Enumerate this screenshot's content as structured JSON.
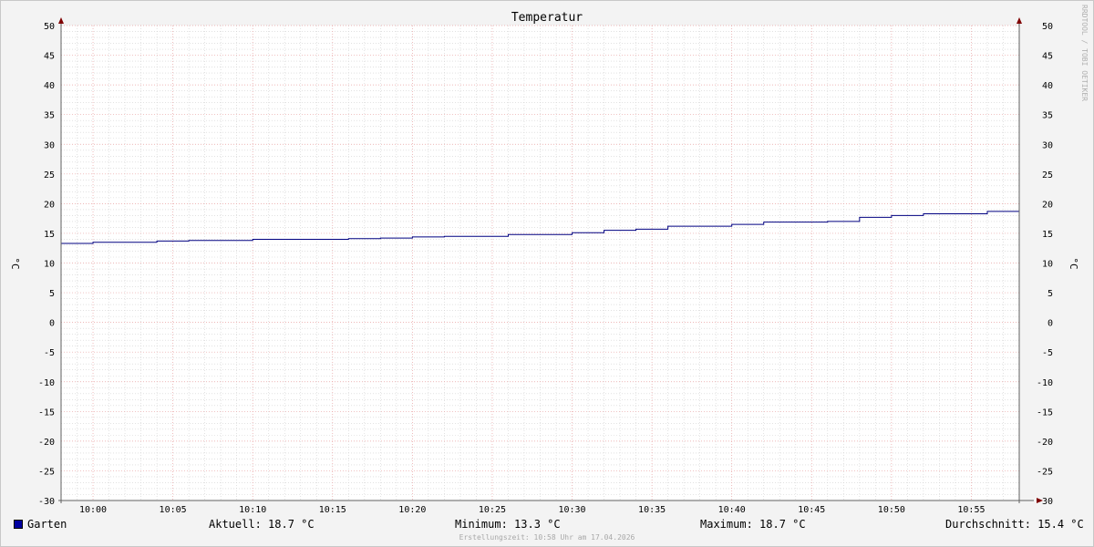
{
  "chart_data": {
    "type": "line",
    "title": "Temperatur",
    "ylabel": "°C",
    "ylabel_right": "°C",
    "ylim": [
      -30,
      50
    ],
    "yticks": [
      50,
      45,
      40,
      35,
      30,
      25,
      20,
      15,
      10,
      5,
      0,
      -5,
      -10,
      -15,
      -20,
      -25,
      -30
    ],
    "xticks": [
      "10:00",
      "10:05",
      "10:10",
      "10:15",
      "10:20",
      "10:25",
      "10:30",
      "10:35",
      "10:40",
      "10:45",
      "10:50",
      "10:55"
    ],
    "xlim_minutes": [
      -2,
      58
    ],
    "grid": true,
    "legend_position": "bottom-left",
    "series": [
      {
        "name": "Garten",
        "color": "#000080",
        "step": true,
        "x_minutes": [
          -2,
          0,
          4,
          6,
          10,
          12,
          14,
          16,
          18,
          20,
          22,
          24,
          26,
          28,
          30,
          32,
          34,
          36,
          38,
          40,
          42,
          44,
          46,
          48,
          50,
          52,
          54,
          56,
          58
        ],
        "values": [
          13.3,
          13.5,
          13.7,
          13.8,
          14.0,
          14.0,
          14.0,
          14.1,
          14.2,
          14.4,
          14.5,
          14.5,
          14.8,
          14.8,
          15.1,
          15.5,
          15.7,
          16.2,
          16.2,
          16.5,
          16.9,
          16.9,
          17.0,
          17.7,
          18.0,
          18.3,
          18.3,
          18.7,
          18.7
        ]
      }
    ]
  },
  "legend": {
    "color": "#000080",
    "name": "Garten",
    "current": "Aktuell: 18.7 °C",
    "minimum": "Minimum: 13.3 °C",
    "maximum": "Maximum: 18.7 °C",
    "average": "Durchschnitt: 15.4 °C"
  },
  "watermark": "RRDTOOL / TOBI OETIKER",
  "footer": "Erstellungszeit: 10:58 Uhr am 17.04.2026",
  "colors": {
    "background": "#f3f3f3",
    "plot": "#ffffff",
    "major_grid": "#e8a0a0",
    "minor_grid": "#d0d0d0",
    "line": "#000080",
    "arrow": "#800000"
  }
}
